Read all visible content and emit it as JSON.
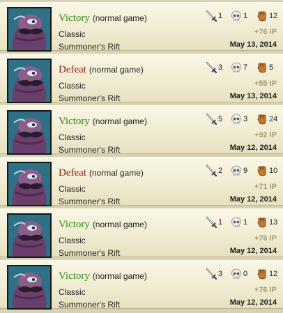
{
  "colors": {
    "victory": "#2f8a12",
    "defeat": "#8e1d0d",
    "ip": "#a59a70",
    "background": "#d9d2b2"
  },
  "icons": {
    "kills": "sword-icon",
    "deaths": "skull-icon",
    "assists": "fist-icon",
    "champion": "champion-portrait"
  },
  "games": [
    {
      "outcome": "Victory",
      "outcome_type": "victory",
      "mode": "(normal game)",
      "queue": "Classic",
      "map": "Summoner's Rift",
      "kills": "1",
      "deaths": "1",
      "assists": "12",
      "ip": "+76 IP",
      "date": "May 13, 2014"
    },
    {
      "outcome": "Defeat",
      "outcome_type": "defeat",
      "mode": "(normal game)",
      "queue": "Classic",
      "map": "Summoner's Rift",
      "kills": "3",
      "deaths": "7",
      "assists": "5",
      "ip": "+55 IP",
      "date": "May 13, 2014"
    },
    {
      "outcome": "Victory",
      "outcome_type": "victory",
      "mode": "(normal game)",
      "queue": "Classic",
      "map": "Summoner's Rift",
      "kills": "5",
      "deaths": "3",
      "assists": "24",
      "ip": "+92 IP",
      "date": "May 12, 2014"
    },
    {
      "outcome": "Defeat",
      "outcome_type": "defeat",
      "mode": "(normal game)",
      "queue": "Classic",
      "map": "Summoner's Rift",
      "kills": "2",
      "deaths": "9",
      "assists": "10",
      "ip": "+71 IP",
      "date": "May 12, 2014"
    },
    {
      "outcome": "Victory",
      "outcome_type": "victory",
      "mode": "(normal game)",
      "queue": "Classic",
      "map": "Summoner's Rift",
      "kills": "1",
      "deaths": "1",
      "assists": "13",
      "ip": "+76 IP",
      "date": "May 12, 2014"
    },
    {
      "outcome": "Victory",
      "outcome_type": "victory",
      "mode": "(normal game)",
      "queue": "Classic",
      "map": "Summoner's Rift",
      "kills": "3",
      "deaths": "0",
      "assists": "12",
      "ip": "+76 IP",
      "date": "May 12, 2014"
    }
  ]
}
